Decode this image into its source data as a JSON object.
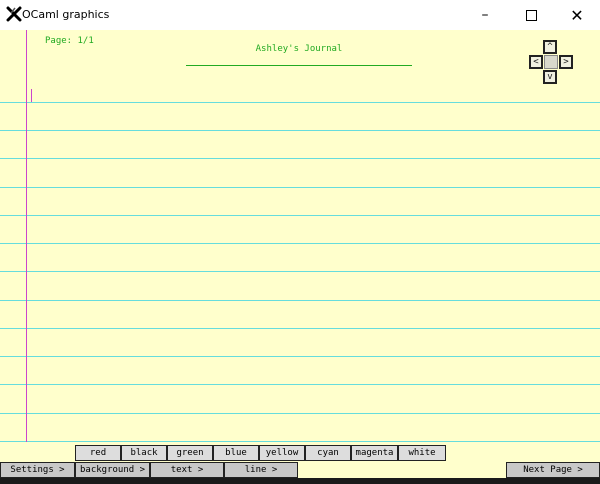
{
  "window": {
    "title": "OCaml graphics",
    "minimize_glyph": "–",
    "close_glyph": "✕"
  },
  "journal": {
    "page_label": "Page: 1/1",
    "title": "Ashley's Journal"
  },
  "dpad": {
    "up": "^",
    "left": "<",
    "right": ">",
    "down": "v"
  },
  "colors": {
    "paper": "#ffffcc",
    "rule_line": "#66dddd",
    "margin_line": "#cc44cc",
    "accent_text": "#22aa22"
  },
  "palette": [
    "red",
    "black",
    "green",
    "blue",
    "yellow",
    "cyan",
    "magenta",
    "white"
  ],
  "menu": {
    "settings": "Settings >",
    "background": "background >",
    "text": "text >",
    "line": "line >",
    "next_page": "Next Page >"
  }
}
